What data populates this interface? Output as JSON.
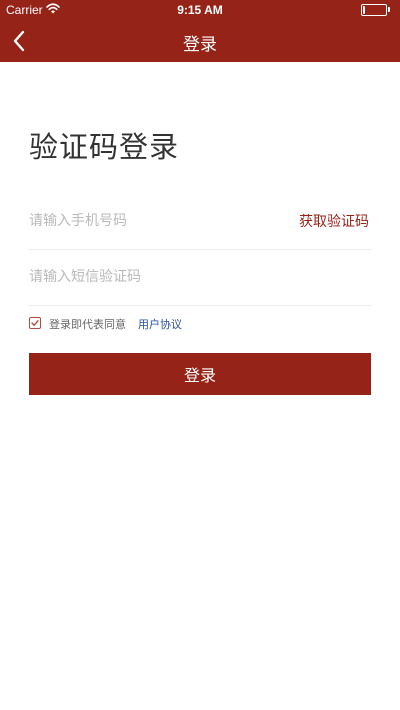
{
  "status_bar": {
    "carrier": "Carrier",
    "time": "9:15 AM",
    "battery_level": 0.1
  },
  "nav": {
    "title": "登录",
    "back_icon": "chevron-left-icon"
  },
  "page": {
    "heading": "验证码登录"
  },
  "form": {
    "phone_placeholder": "请输入手机号码",
    "phone_value": "",
    "get_code_label": "获取验证码",
    "code_placeholder": "请输入短信验证码",
    "code_value": "",
    "agree_checked": true,
    "agree_text": "登录即代表同意",
    "agreement_link": "用户协议",
    "submit_label": "登录"
  },
  "colors": {
    "brand": "#962318",
    "link": "#2a4f98",
    "placeholder": "#b9b9b9"
  }
}
